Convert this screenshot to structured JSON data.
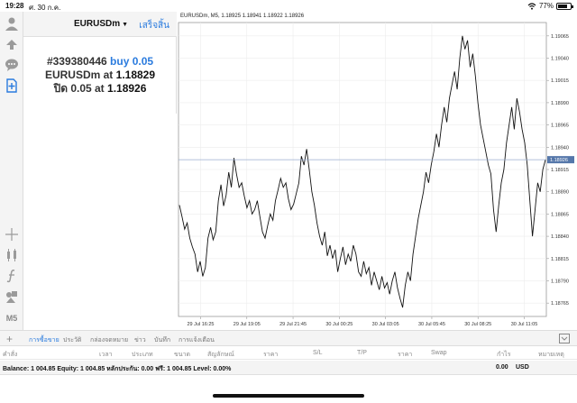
{
  "status_bar": {
    "time": "19:28",
    "date": "ศ. 30 ก.ค.",
    "battery": "77%",
    "battery_level": 0.77
  },
  "panel": {
    "symbol": "EURUSDm",
    "done_label": "เสร็จสิ้น",
    "order_id": "#339380446",
    "order_side": "buy 0.05",
    "open_line_prefix": "EURUSDm at",
    "open_price": "1.18829",
    "close_line_prefix": "ปิด 0.05 at",
    "close_price": "1.18926"
  },
  "toolbar": {
    "timeframe": "M5",
    "icons": [
      "user-icon",
      "orders-icon",
      "chat-icon",
      "add-document-icon",
      "crosshair-icon",
      "indicators-icon",
      "function-icon",
      "objects-icon",
      "timeframe-icon"
    ]
  },
  "chart_data": {
    "type": "line",
    "symbol_info": "EURUSDm, M5, 1.18925 1.18941 1.18922 1.18926",
    "current_price": 1.18926,
    "current_price_label": "1.18926",
    "ylim": [
      1.1875,
      1.1908
    ],
    "y_ticks": [
      "1.19065",
      "1.19040",
      "1.19015",
      "1.18990",
      "1.18965",
      "1.18940",
      "1.18915",
      "1.18890",
      "1.18865",
      "1.18840",
      "1.18815",
      "1.18790",
      "1.18765"
    ],
    "x_ticks": [
      "29 Jul 16:25",
      "29 Jul 19:05",
      "29 Jul 21:45",
      "30 Jul 00:25",
      "30 Jul 03:05",
      "30 Jul 05:45",
      "30 Jul 08:25",
      "30 Jul 11:05"
    ],
    "grid": true,
    "series": [
      {
        "values": [
          1.18875,
          1.18862,
          1.18848,
          1.18855,
          1.18838,
          1.18828,
          1.1882,
          1.188,
          1.18812,
          1.18795,
          1.18805,
          1.18838,
          1.1885,
          1.18836,
          1.18845,
          1.1888,
          1.18898,
          1.18874,
          1.18886,
          1.18912,
          1.18895,
          1.18928,
          1.1891,
          1.18895,
          1.189,
          1.18885,
          1.18872,
          1.1888,
          1.18865,
          1.1887,
          1.1888,
          1.18862,
          1.18845,
          1.18838,
          1.18852,
          1.18865,
          1.18858,
          1.1888,
          1.18892,
          1.18905,
          1.18895,
          1.189,
          1.18882,
          1.1887,
          1.18876,
          1.18888,
          1.189,
          1.1893,
          1.1892,
          1.18938,
          1.18915,
          1.1889,
          1.18875,
          1.18855,
          1.1884,
          1.1883,
          1.18845,
          1.18818,
          1.1883,
          1.18815,
          1.18825,
          1.188,
          1.18815,
          1.18828,
          1.18808,
          1.1882,
          1.18812,
          1.1883,
          1.1882,
          1.188,
          1.18795,
          1.18812,
          1.18798,
          1.18805,
          1.18785,
          1.188,
          1.1879,
          1.1878,
          1.18795,
          1.18782,
          1.18788,
          1.18775,
          1.1879,
          1.188,
          1.18782,
          1.1877,
          1.1876,
          1.18785,
          1.188,
          1.1879,
          1.1882,
          1.1884,
          1.1886,
          1.18875,
          1.1889,
          1.18912,
          1.189,
          1.1892,
          1.18935,
          1.18955,
          1.1894,
          1.18965,
          1.18985,
          1.18968,
          1.18995,
          1.1901,
          1.19025,
          1.19005,
          1.1904,
          1.19065,
          1.1905,
          1.1906,
          1.1903,
          1.19045,
          1.1902,
          1.1899,
          1.18965,
          1.1895,
          1.18935,
          1.1892,
          1.1891,
          1.1887,
          1.18845,
          1.18875,
          1.189,
          1.18915,
          1.18945,
          1.18965,
          1.18985,
          1.1896,
          1.18995,
          1.1898,
          1.1896,
          1.18945,
          1.1892,
          1.1888,
          1.1884,
          1.1887,
          1.189,
          1.1889,
          1.18915,
          1.18926
        ]
      }
    ]
  },
  "bottom_tabs": [
    "การซื้อขาย",
    "ประวัติ",
    "กล่องจดหมาย",
    "ข่าว",
    "บันทึก",
    "การแจ้งเตือน"
  ],
  "table_header": {
    "order": "คำสั่ง",
    "time": "เวลา",
    "type": "ประเภท",
    "volume": "ขนาด",
    "symbol": "สัญลักษณ์",
    "price": "ราคา",
    "sl": "S/L",
    "tp": "T/P",
    "price2": "ราคา",
    "swap": "Swap",
    "profit": "กำไร",
    "comment": "หมายเหตุ"
  },
  "balance_row": {
    "text": "Balance: 1 004.85 Equity: 1 004.85 หลักประกัน: 0.00 ฟรี: 1 004.85 Level: 0.00%",
    "profit": "0.00",
    "currency": "USD"
  }
}
